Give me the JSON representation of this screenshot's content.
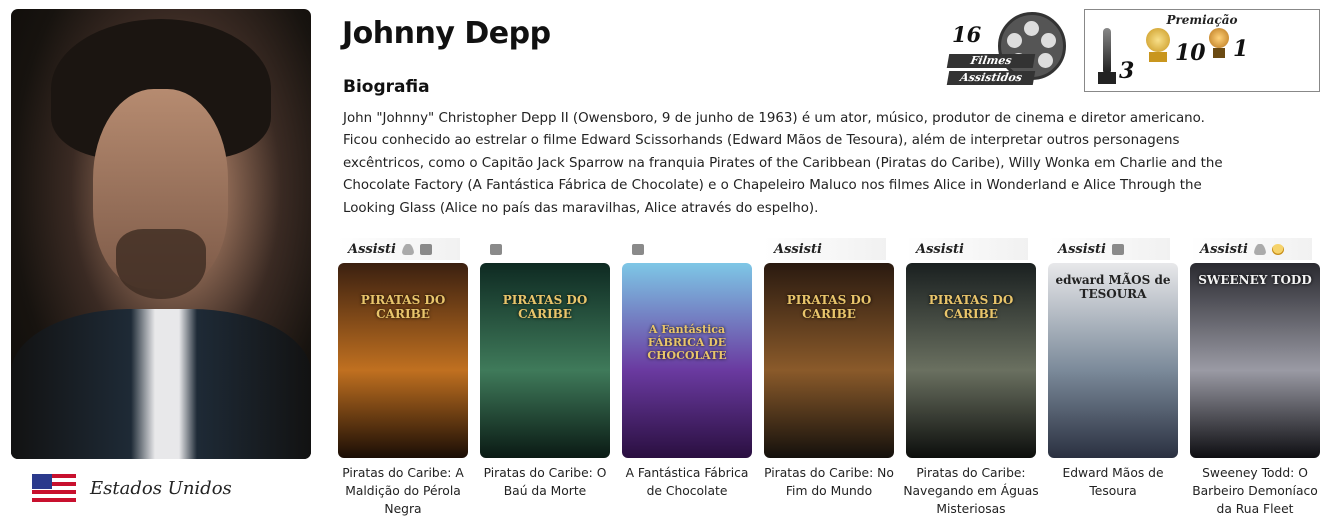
{
  "actor": {
    "name": "Johnny Depp",
    "country": "Estados Unidos"
  },
  "bio": {
    "heading": "Biografia",
    "text": "John \"Johnny\" Christopher Depp II (Owensboro, 9 de junho de 1963) é um ator, músico, produtor de cinema e diretor americano. Ficou conhecido ao estrelar o filme Edward Scissorhands (Edward Mãos de Tesoura), além de interpretar outros personagens excêntricos, como o Capitão Jack Sparrow na franquia Pirates of the Caribbean (Piratas do Caribe), Willy Wonka em Charlie and the Chocolate Factory (A Fantástica Fábrica de Chocolate) e o Chapeleiro Maluco nos filmes Alice in Wonderland e Alice Through the Looking Glass (Alice no país das maravilhas, Alice através do espelho)."
  },
  "watched_badge": {
    "count": "16",
    "line1": "Filmes",
    "line2": "Assistidos"
  },
  "awards": {
    "title": "Premiação",
    "items": [
      {
        "icon": "oscar-statuette-icon",
        "count": "3"
      },
      {
        "icon": "golden-globe-icon",
        "count": "10"
      },
      {
        "icon": "globe-trophy-icon",
        "count": "1"
      }
    ]
  },
  "films": [
    {
      "status": "Assisti",
      "icons": [
        "person-icon",
        "film-reel-icon"
      ],
      "title": "Piratas do Caribe: A Maldição do Pérola Negra",
      "poster_colors": [
        "#3b2010",
        "#c07020",
        "#1a0d05"
      ]
    },
    {
      "status": "",
      "icons": [
        "film-reel-icon"
      ],
      "title": "Piratas do Caribe: O Baú da Morte",
      "poster_colors": [
        "#0e2a22",
        "#3f7a5a",
        "#0a1a14"
      ]
    },
    {
      "status": "",
      "icons": [
        "film-reel-icon"
      ],
      "title": "A Fantástica Fábrica de Chocolate",
      "poster_colors": [
        "#7ec7e6",
        "#6a3aa0",
        "#2a0f40"
      ]
    },
    {
      "status": "Assisti",
      "icons": [],
      "title": "Piratas do Caribe: No Fim do Mundo",
      "poster_colors": [
        "#2a1a10",
        "#8a5a2a",
        "#14100c"
      ]
    },
    {
      "status": "Assisti",
      "icons": [],
      "title": "Piratas do Caribe: Navegando em Águas Misteriosas",
      "poster_colors": [
        "#1a2020",
        "#6a7060",
        "#0c0e0c"
      ]
    },
    {
      "status": "Assisti",
      "icons": [
        "film-reel-icon"
      ],
      "title": "Edward Mãos de Tesoura",
      "poster_colors": [
        "#e8e8ea",
        "#7b8a9a",
        "#2a3040"
      ]
    },
    {
      "status": "Assisti",
      "icons": [
        "person-icon",
        "trophy-icon"
      ],
      "title": "Sweeney Todd: O Barbeiro Demoníaco da Rua Fleet",
      "poster_colors": [
        "#2a2a30",
        "#9a9aa4",
        "#0e0e12"
      ]
    }
  ],
  "poster_logos": [
    "PIRATAS DO CARIBE",
    "PIRATAS DO CARIBE",
    "A Fantástica FÁBRICA DE CHOCOLATE",
    "PIRATAS DO CARIBE",
    "PIRATAS DO CARIBE",
    "edward MÃOS de TESOURA",
    "SWEENEY TODD"
  ]
}
